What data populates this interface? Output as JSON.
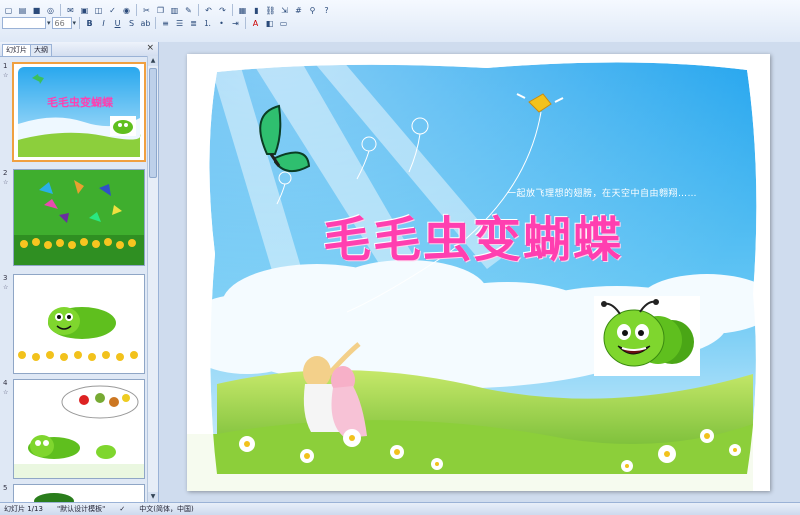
{
  "toolbar": {
    "font_name": "",
    "font_size": "66",
    "row1_icons": [
      "new-icon",
      "open-icon",
      "save-icon",
      "permission-icon",
      "email-icon",
      "print-icon",
      "preview-icon",
      "spelling-icon",
      "research-icon",
      "cut-icon",
      "copy-icon",
      "paste-icon",
      "format-painter-icon",
      "undo-icon",
      "redo-icon",
      "insert-table-icon",
      "chart-icon",
      "hyperlink-icon",
      "expand-icon",
      "grid-icon",
      "zoom-icon",
      "help-icon"
    ],
    "row2_icons": [
      "bold-icon",
      "italic-icon",
      "underline-icon",
      "shadow-icon",
      "strikethrough-icon",
      "align-left-icon",
      "center-icon",
      "align-right-icon",
      "numbering-icon",
      "bullets-icon",
      "indent-icon",
      "font-color-icon",
      "design-icon",
      "new-slide-icon"
    ]
  },
  "left_pane": {
    "tab_slides": "幻灯片",
    "tab_outline": "大纲",
    "close": "×",
    "thumbnails": [
      {
        "number": "1",
        "title": "毛毛虫变蝴蝶"
      },
      {
        "number": "2"
      },
      {
        "number": "3"
      },
      {
        "number": "4"
      },
      {
        "number": "5"
      }
    ]
  },
  "slide": {
    "title": "毛毛虫变蝴蝶",
    "subtitle": "一起放飞理想的翅膀，在天空中自由翱翔……"
  },
  "statusbar": {
    "slide_info": "幻灯片 1/13",
    "template": "\"默认设计模板\"",
    "language": "中文(简体，中国)"
  },
  "colors": {
    "sky": "#3fb6ef",
    "title_pink": "#ff3fb0",
    "grass": "#7cc43a",
    "caterpillar": "#5fbf1e"
  }
}
